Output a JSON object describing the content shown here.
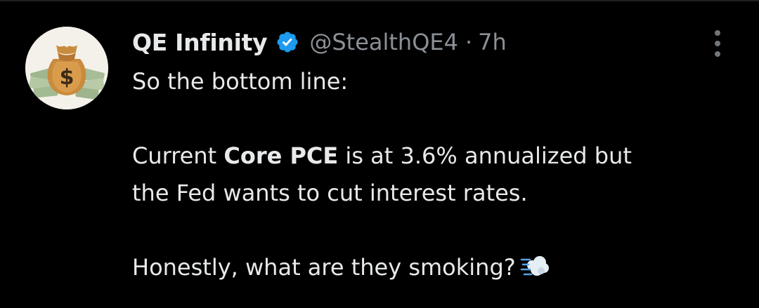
{
  "tweet": {
    "display_name": "QE Infinity",
    "handle": "@StealthQE4",
    "separator": "·",
    "time": "7h",
    "lines": {
      "l1": "So the bottom line:",
      "l2_pre": "Current ",
      "l2_bold": "Core PCE",
      "l2_post": " is at 3.6% annualized but",
      "l3": "the Fed wants to cut interest rates.",
      "l4": "Honestly, what are they smoking?"
    }
  },
  "icons": {
    "verified": "verified-badge-icon",
    "more": "more-vertical-icon",
    "emoji": "dash-symbol-emoji",
    "avatar": "money-bag-avatar"
  },
  "colors": {
    "background": "#000000",
    "text_primary": "#e7e9ea",
    "text_secondary": "#8b9096",
    "verified_blue": "#1d9bf0",
    "avatar_bg": "#f4f1ea"
  }
}
